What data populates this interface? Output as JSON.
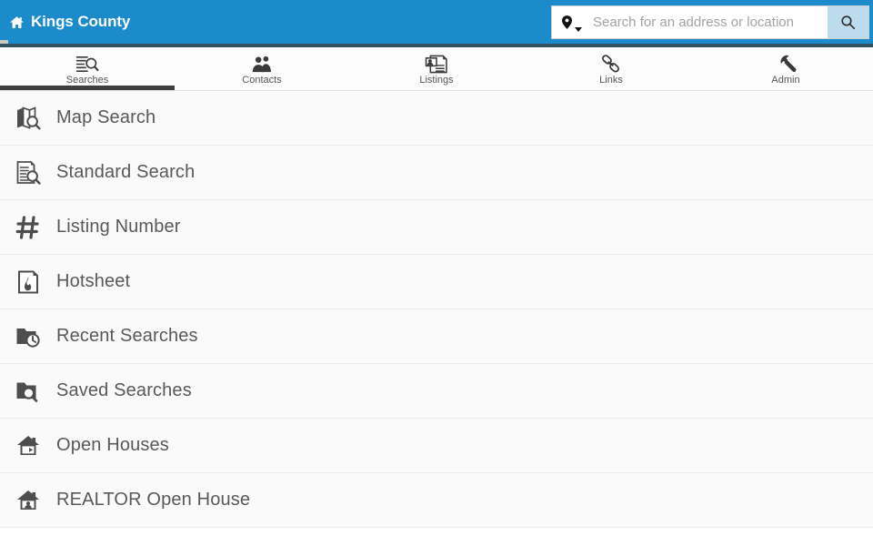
{
  "theme": {
    "header_blue": "#1b8bcb",
    "header_strip": "#30505d",
    "search_button_blue": "#bcdcee",
    "active_tab_underline": "#3f3f3f",
    "list_bg": "#fafafa",
    "list_text": "#595959"
  },
  "header": {
    "home_icon": "home-icon",
    "title": "Kings County"
  },
  "search": {
    "scope_icon": "map-pin-icon",
    "scope_caret_icon": "chevron-down-icon",
    "placeholder": "Search for an address or location",
    "value": "",
    "submit_icon": "search-icon"
  },
  "tabs": [
    {
      "label": "Searches",
      "icon": "document-search-icon",
      "active": true
    },
    {
      "label": "Contacts",
      "icon": "contacts-icon",
      "active": false
    },
    {
      "label": "Listings",
      "icon": "listings-icon",
      "active": false
    },
    {
      "label": "Links",
      "icon": "link-chain-icon",
      "active": false
    },
    {
      "label": "Admin",
      "icon": "wrench-icon",
      "active": false
    }
  ],
  "menu": {
    "items": [
      {
        "label": "Map Search",
        "icon": "map-search-icon"
      },
      {
        "label": "Standard Search",
        "icon": "document-search-icon"
      },
      {
        "label": "Listing Number",
        "icon": "hash-icon"
      },
      {
        "label": "Hotsheet",
        "icon": "flame-document-icon"
      },
      {
        "label": "Recent Searches",
        "icon": "folder-clock-icon"
      },
      {
        "label": "Saved Searches",
        "icon": "folder-search-icon"
      },
      {
        "label": "Open Houses",
        "icon": "house-arrow-icon"
      },
      {
        "label": "REALTOR Open House",
        "icon": "house-person-icon"
      }
    ]
  }
}
